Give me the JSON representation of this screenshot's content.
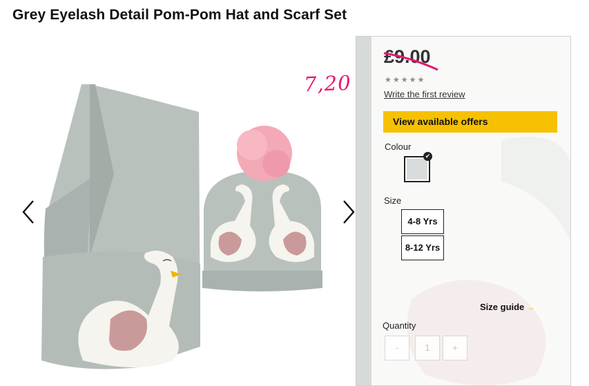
{
  "product": {
    "title": "Grey Eyelash Detail Pom-Pom Hat and Scarf Set",
    "price": "£9.00",
    "handwritten_price": "7,20",
    "review_link": "Write the first review",
    "rating_stars": 5,
    "offers_button": "View available offers",
    "colour_label": "Colour",
    "colour_swatch_color": "#d9dcdd",
    "size_label": "Size",
    "sizes": [
      "4-8 Yrs",
      "8-12 Yrs"
    ],
    "size_guide": "Size guide",
    "quantity_label": "Quantity",
    "quantity": {
      "minus": "-",
      "value": "1",
      "plus": "+"
    }
  },
  "colors": {
    "accent_yellow": "#f6c100",
    "handwriting_pink": "#e8176f",
    "knit_grey": "#b9c1bd",
    "pompom_pink": "#f4a9b6"
  },
  "icons": {
    "prev": "chevron-left-icon",
    "next": "chevron-right-icon",
    "star": "star-icon",
    "check": "check-icon",
    "size_guide_arrow": "arrow-right-icon"
  }
}
